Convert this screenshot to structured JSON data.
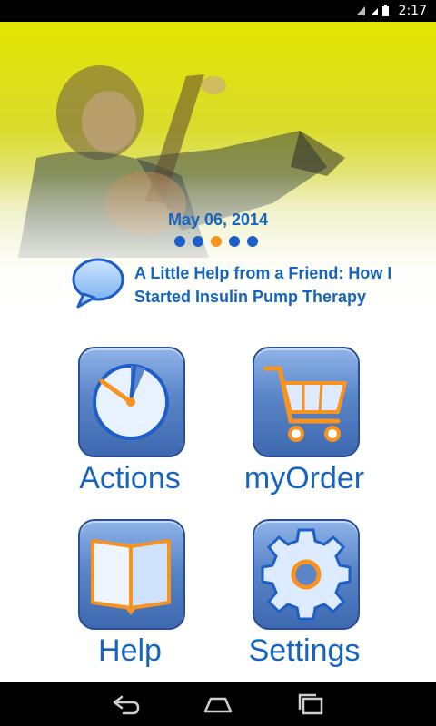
{
  "status_bar": {
    "time": "2:17"
  },
  "hero": {
    "date": "May 06, 2014",
    "headline": "A Little Help from a Friend: How I Started Insulin Pump Therapy",
    "carousel": {
      "count": 5,
      "active_index": 2
    }
  },
  "tiles": [
    {
      "label": "Actions",
      "icon": "timer-icon"
    },
    {
      "label": "myOrder",
      "icon": "cart-icon"
    },
    {
      "label": "Help",
      "icon": "book-icon"
    },
    {
      "label": "Settings",
      "icon": "gear-icon"
    }
  ],
  "nav": {
    "back": "back-icon",
    "home": "home-icon",
    "recents": "recents-icon"
  },
  "colors": {
    "accent": "#1565c0",
    "active_dot": "#f7931e",
    "tile_dark": "#3e69b0",
    "hero_yellow": "#e3e600"
  }
}
